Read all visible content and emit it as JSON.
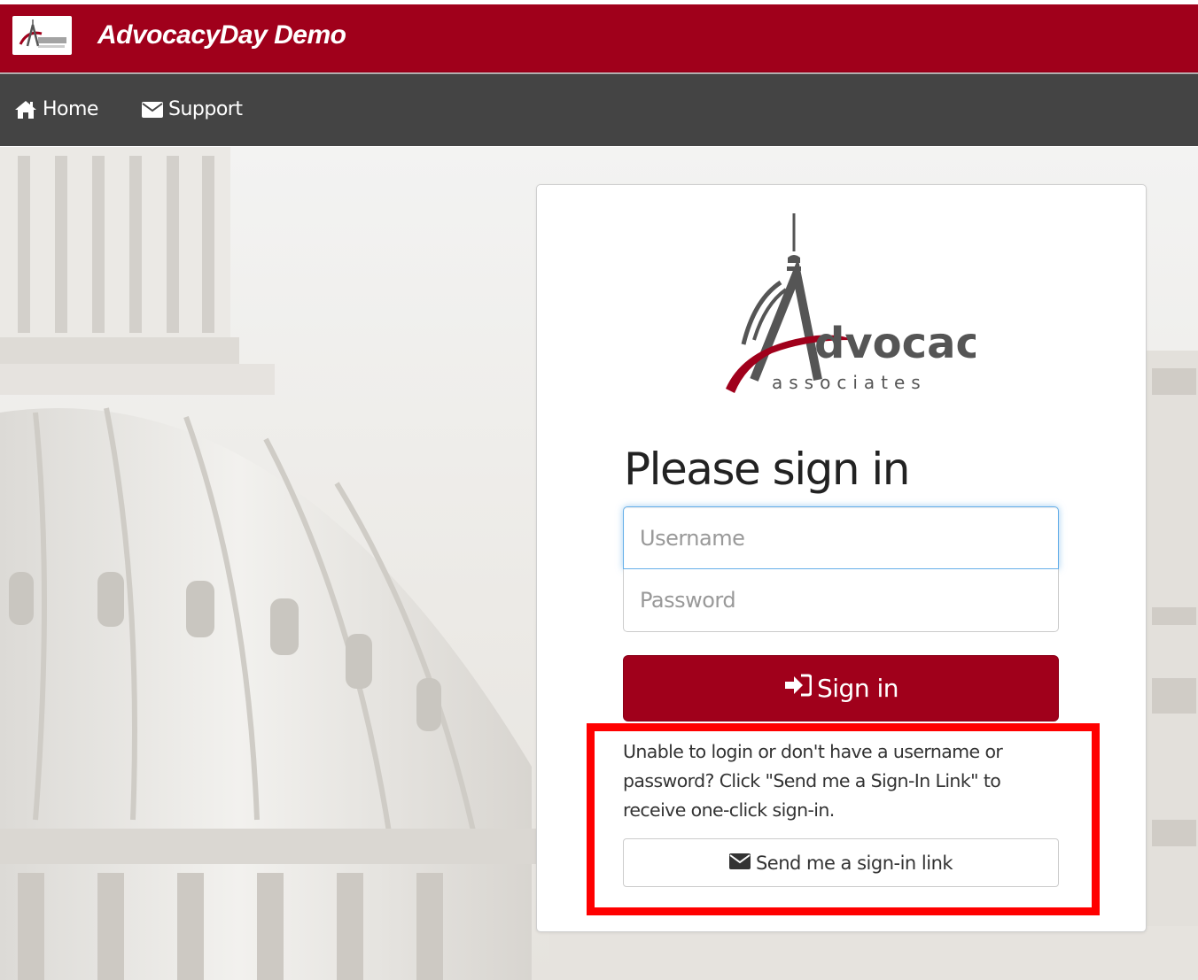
{
  "header": {
    "title": "AdvocacyDay Demo",
    "brand_color": "#a0001b",
    "logo_icon": "advocacy-logo"
  },
  "nav": {
    "items": [
      {
        "label": "Home",
        "icon": "home-icon"
      },
      {
        "label": "Support",
        "icon": "envelope-icon"
      }
    ],
    "background": "#444444"
  },
  "login": {
    "logo": {
      "word": "dvocacy",
      "initial": "A",
      "subtitle": "associates"
    },
    "heading": "Please sign in",
    "username_placeholder": "Username",
    "password_placeholder": "Password",
    "signin_label": "Sign in",
    "help_text": "Unable to login or don't have a username or password? Click \"Send me a Sign-In Link\" to receive one-click sign-in.",
    "link_button_label": "Send me a sign-in link"
  },
  "annotation": {
    "highlight_color": "#ff0000"
  }
}
